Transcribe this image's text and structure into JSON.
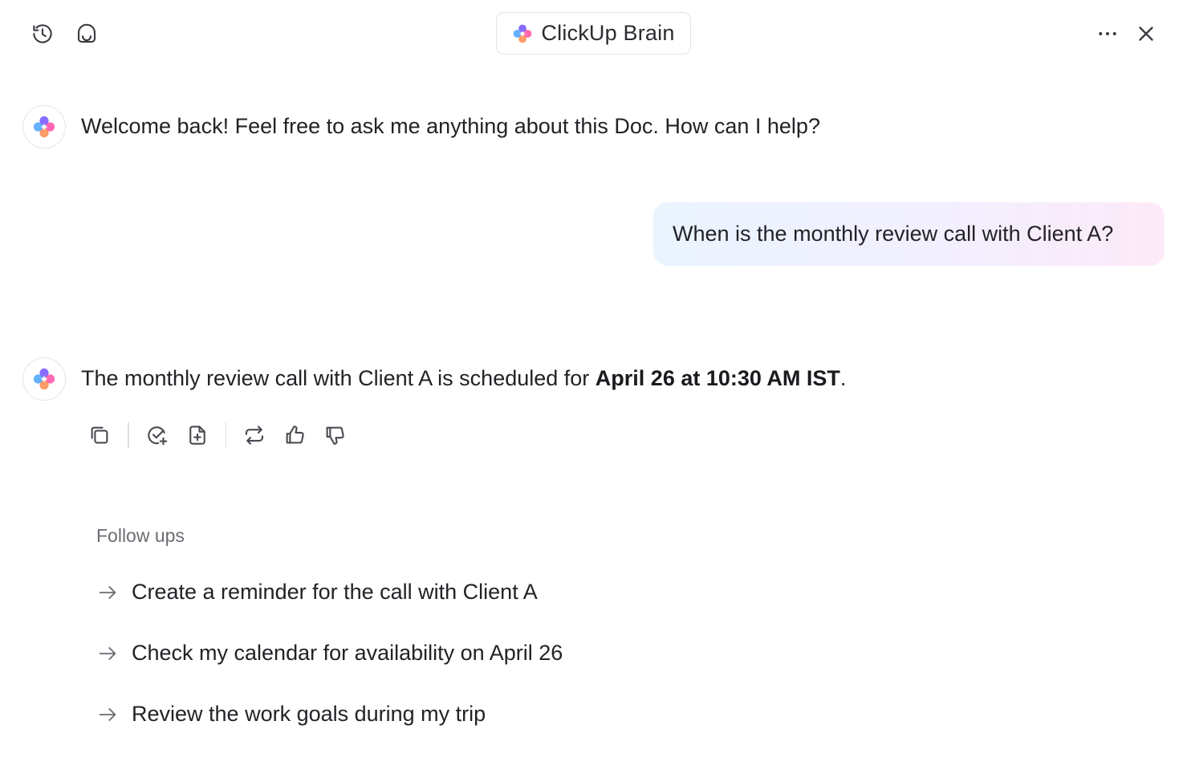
{
  "header": {
    "title": "ClickUp Brain",
    "left_icons": [
      "history-icon",
      "inbox-icon"
    ],
    "right_icons": [
      "more-icon",
      "close-icon"
    ]
  },
  "messages": {
    "welcome": "Welcome back! Feel free to ask me anything about this Doc. How can I help?",
    "user_question": "When is the monthly review call with Client A?",
    "answer_prefix": "The monthly review call with Client A is scheduled for ",
    "answer_bold": "April 26 at 10:30 AM IST",
    "answer_suffix": "."
  },
  "actions": [
    "copy-icon",
    "create-task-icon",
    "add-to-doc-icon",
    "regenerate-icon",
    "thumbs-up-icon",
    "thumbs-down-icon"
  ],
  "follow_ups": {
    "heading": "Follow ups",
    "items": [
      "Create a reminder for the call with Client A",
      "Check my calendar for availability on April 26",
      "Review the work goals during my trip"
    ]
  },
  "colors": {
    "bubble_start": "#eaf4ff",
    "bubble_end": "#fdeaf8",
    "logo_purple": "#7b5cff",
    "logo_pink": "#ff4fa3",
    "logo_blue": "#4aa3ff",
    "logo_orange": "#ff8a4c"
  }
}
